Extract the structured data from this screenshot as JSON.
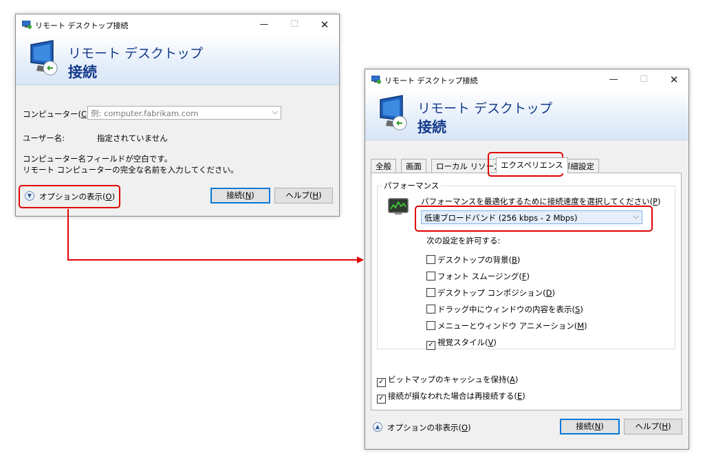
{
  "window1": {
    "title": "リモート デスクトップ接続",
    "banner_line1": "リモート デスクトップ",
    "banner_line2": "接続",
    "computer_label_prefix": "コンピューター(",
    "computer_label_key": "C",
    "computer_label_suffix": "):",
    "computer_placeholder": "例: computer.fabrikam.com",
    "username_label": "ユーザー名:",
    "username_value": "指定されていません",
    "message_line1": "コンピューター名フィールドが空白です。",
    "message_line2": "リモート コンピューターの完全な名前を入力してください。",
    "show_options_prefix": "オプションの表示(",
    "show_options_key": "O",
    "show_options_suffix": ")",
    "connect_prefix": "接続(",
    "connect_key": "N",
    "connect_suffix": ")",
    "help_prefix": "ヘルプ(",
    "help_key": "H",
    "help_suffix": ")"
  },
  "window2": {
    "title": "リモート デスクトップ接続",
    "banner_line1": "リモート デスクトップ",
    "banner_line2": "接続",
    "tabs": [
      "全般",
      "画面",
      "ローカル リソース",
      "エクスペリエンス",
      "詳細設定"
    ],
    "active_tab": "エクスペリエンス",
    "performance_group": "パフォーマンス",
    "speed_label_prefix": "パフォーマンスを最適化するために接続速度を選択してください(",
    "speed_label_key": "P",
    "speed_label_suffix": ")",
    "speed_value": "低速ブロードバンド (256 kbps - 2 Mbps)",
    "allow_label": "次の設定を許可する:",
    "checkboxes": [
      {
        "prefix": "デスクトップの背景(",
        "key": "B",
        "suffix": ")",
        "checked": false
      },
      {
        "prefix": "フォント スムージング(",
        "key": "F",
        "suffix": ")",
        "checked": false
      },
      {
        "prefix": "デスクトップ コンポジション(",
        "key": "D",
        "suffix": ")",
        "checked": false
      },
      {
        "prefix": "ドラッグ中にウィンドウの内容を表示(",
        "key": "S",
        "suffix": ")",
        "checked": false
      },
      {
        "prefix": "メニューとウィンドウ アニメーション(",
        "key": "M",
        "suffix": ")",
        "checked": false
      },
      {
        "prefix": "視覚スタイル(",
        "key": "V",
        "suffix": ")",
        "checked": true
      }
    ],
    "bitmap_cache": {
      "prefix": "ビットマップのキャッシュを保持(",
      "key": "A",
      "suffix": ")",
      "checked": true
    },
    "reconnect": {
      "prefix": "接続が損なわれた場合は再接続する(",
      "key": "E",
      "suffix": ")",
      "checked": true
    },
    "hide_options_prefix": "オプションの非表示(",
    "hide_options_key": "O",
    "hide_options_suffix": ")",
    "connect_prefix": "接続(",
    "connect_key": "N",
    "connect_suffix": ")",
    "help_prefix": "ヘルプ(",
    "help_key": "H",
    "help_suffix": ")"
  },
  "colors": {
    "highlight": "#e00000",
    "banner_text": "#153a8a",
    "focus_border": "#0078d7"
  },
  "window_controls": {
    "minimize": "—",
    "maximize": "☐",
    "close": "✕"
  },
  "check_mark": "✓",
  "dropdown_arrow": "⌵",
  "expand_glyph": "▼",
  "collapse_glyph": "▲"
}
